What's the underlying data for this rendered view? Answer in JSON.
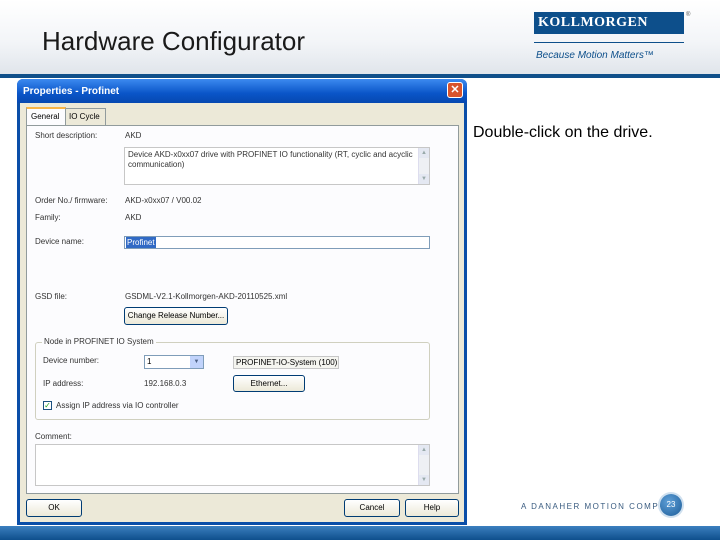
{
  "slide": {
    "title": "Hardware Configurator",
    "caption": "Double-click on the drive.",
    "logo_text": "KOLLMORGEN",
    "logo_tm": "®",
    "tagline": "Because Motion Matters™",
    "footer_brand": "A DANAHER MOTION COMPANY",
    "page_number": "23"
  },
  "dialog": {
    "title": "Properties - Profinet",
    "close_glyph": "✕",
    "tabs": [
      {
        "label": "General",
        "active": true
      },
      {
        "label": "IO Cycle",
        "active": false
      }
    ],
    "general": {
      "short_description_label": "Short description:",
      "short_description_value": "AKD",
      "description_text": "Device AKD-x0xx07 drive with PROFINET IO functionality (RT, cyclic and acyclic communication)",
      "order_label": "Order No./ firmware:",
      "order_value": "AKD-x0xx07 / V00.02",
      "family_label": "Family:",
      "family_value": "AKD",
      "device_name_label": "Device name:",
      "device_name_value": "Profinet",
      "gsd_label": "GSD file:",
      "gsd_value": "GSDML-V2.1-Kollmorgen-AKD-20110525.xml",
      "change_release_button": "Change Release Number...",
      "node_group_title": "Node in PROFINET IO System",
      "device_number_label": "Device number:",
      "device_number_value": "1",
      "io_system_value": "PROFINET-IO-System (100)",
      "ip_label": "IP address:",
      "ip_value": "192.168.0.3",
      "ethernet_button": "Ethernet...",
      "assign_checkbox_label": "Assign IP address via IO controller",
      "assign_checked": true,
      "comment_label": "Comment:",
      "comment_value": ""
    },
    "buttons": {
      "ok": "OK",
      "cancel": "Cancel",
      "help": "Help"
    }
  },
  "colors": {
    "brand_blue": "#0d4f8b",
    "xp_title_blue": "#0a55c8",
    "dialog_face": "#ece9d8"
  }
}
